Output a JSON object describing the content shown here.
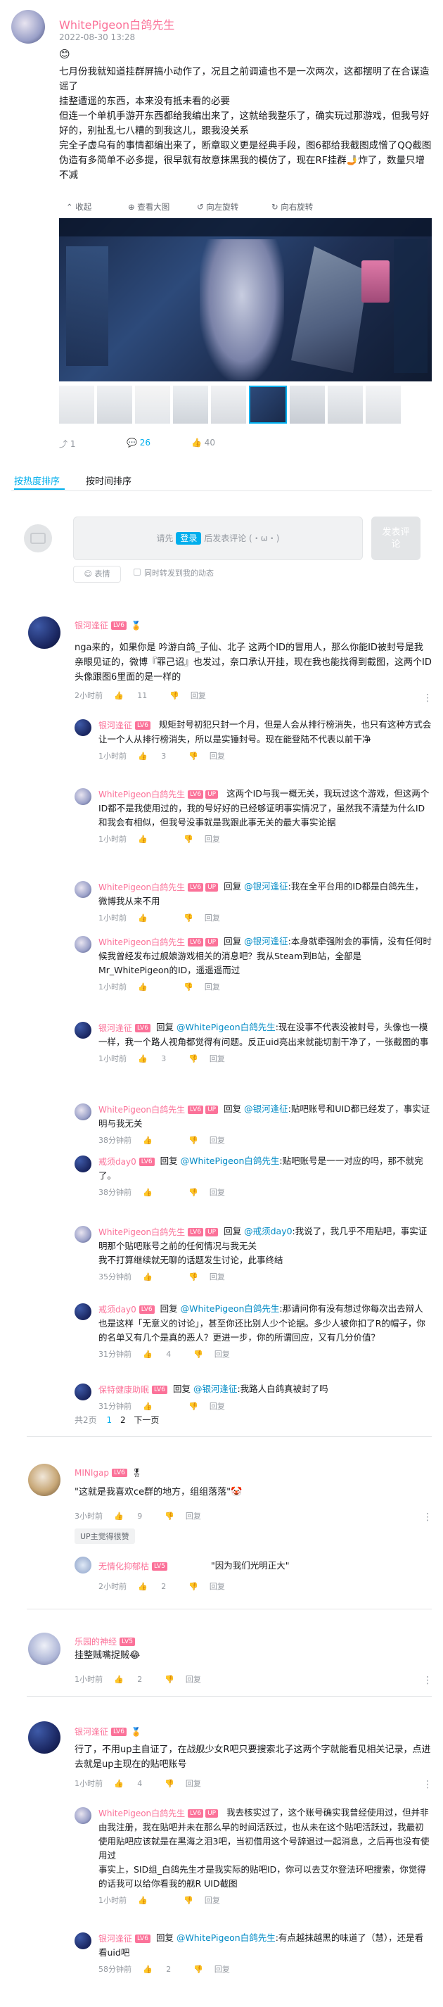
{
  "post": {
    "author": "WhitePigeon白鸽先生",
    "date": "2022-08-30 13:28",
    "emoji": "😊",
    "body": "七月份我就知道挂群屏搞小动作了，况且之前调遣也不是一次两次，这都摆明了在合谋造谣了\n挂整遭遥的东西，本来没有抵未看的必要\n但连一个单机手游开东西都给我编出来了，这就给我整乐了，确实玩过那游戏，但我号好好的，别扯乱七八糟的到我这儿，跟我没关系\n完全子虚乌有的事情都编出来了，断章取义更是经典手段，图6都给我截图成憎了QQ截图伪造有多简单不必多提，很早就有故意抹黑我的模仿了，现在RF挂群🤳炸了，数量只增不减",
    "viewer": {
      "collapse": "收起",
      "view_large": "查看大图",
      "rotate_left": "向左旋转",
      "rotate_right": "向右旋转"
    },
    "stats": {
      "forward": "1",
      "comment": "26",
      "like": "40"
    }
  },
  "sort": {
    "hot": "按热度排序",
    "time": "按时间排序"
  },
  "editor": {
    "prefix": "请先",
    "login": "登录",
    "suffix": "后发表评论 (・ω・)",
    "send": "发表评论",
    "emoji": "表情",
    "checkbox": "同时转发到我的动态"
  },
  "comments": [
    {
      "user": "银河逢征",
      "text": "nga来的，如果你是 吟游白鸽_子仙、北子 这两个ID的冒用人，那么你能ID被封号是我亲眼见证的，微博『罪己诏』也发过，奈口承认开挂，现在我也能找得到截图，这两个ID头像跟图6里面的是一样的",
      "time": "2小时前",
      "likes": "11",
      "reply": "回复"
    },
    {
      "user": "MINIgap",
      "text": "\"这就是我喜欢ce群的地方，组组落落\"🤡",
      "time": "3小时前",
      "likes": "9",
      "reply": "回复",
      "up": "UP主觉得很赞"
    },
    {
      "user": "乐园的神经",
      "text": "挂整贼嘴捉贼😂",
      "time": "1小时前",
      "likes": "2",
      "reply": "回复"
    },
    {
      "user": "银河逢征",
      "text": "行了，不用up主自证了，在战舰少女R吧只要搜索北子这两个字就能看见相关记录，点进去就是up主现在的贴吧账号",
      "time": "1小时前",
      "likes": "4",
      "reply": "回复"
    }
  ],
  "subs1": [
    {
      "user": "银河逢征",
      "text": "规矩封号初犯只封一个月，但是人会从排行榜消失，也只有这种方式会让一个人从排行榜消失，所以是实锤封号。现在能登陆不代表以前干净",
      "time": "1小时前",
      "likes": "3",
      "reply": "回复"
    },
    {
      "user": "WhitePigeon白鸽先生",
      "text": "这两个ID与我一概无关，我玩过这个游戏，但这两个ID都不是我使用过的，我的号好好的已经够证明事实情况了，虽然我不清楚为什么ID和我会有相似，但我号没事就是我跟此事无关的最大事实论据",
      "time": "1小时前",
      "likes": "",
      "reply": "回复"
    },
    {
      "user": "WhitePigeon白鸽先生",
      "pre": "回复",
      "at": "@银河逢征",
      "text": ":我在全平台用的ID都是白鸽先生，微博我从来不用",
      "time": "1小时前",
      "likes": "",
      "reply": "回复"
    },
    {
      "user": "WhitePigeon白鸽先生",
      "pre": "回复",
      "at": "@银河逢征",
      "text": ":本身就牵强附会的事情，没有任何时候我曾经发布过舰娘游戏相关的消息吧？我从Steam到B站，全部是Mr_WhitePigeon的ID，遥遥遥而过",
      "time": "1小时前",
      "likes": "",
      "reply": "回复"
    },
    {
      "user": "银河逢征",
      "pre": "回复",
      "at": "@WhitePigeon白鸽先生",
      "text": ":现在没事不代表没被封号，头像也一模一样，我一个路人视角都觉得有问题。反正uid亮出来就能切割干净了，一张截图的事",
      "time": "1小时前",
      "likes": "3",
      "reply": "回复"
    },
    {
      "user": "WhitePigeon白鸽先生",
      "pre": "回复",
      "at": "@银河逢征",
      "text": ":贴吧账号和UID都已经发了，事实证明与我无关",
      "time": "38分钟前",
      "likes": "",
      "reply": "回复"
    },
    {
      "user": "戒须day0",
      "pre": "回复",
      "at": "@WhitePigeon白鸽先生",
      "text": ":贴吧账号是一一对应的吗，那不就完了。",
      "time": "38分钟前",
      "likes": "",
      "reply": "回复"
    },
    {
      "user": "WhitePigeon白鸽先生",
      "pre": "回复",
      "at": "@戒须day0",
      "text": ":我说了，我几乎不用贴吧，事实证明那个贴吧账号之前的任何情况与我无关\n我不打算继续就无聊的话题发生讨论，此事终结",
      "time": "35分钟前",
      "likes": "",
      "reply": "回复"
    },
    {
      "user": "戒须day0",
      "pre": "回复",
      "at": "@WhitePigeon白鸽先生",
      "text": ":那请问你有没有想过你每次出去辩人也是这样「无意义的讨论」，甚至你还比别人少个论据。多少人被你扣了R的帽子，你的名单又有几个是真的恶人？更进一步，你的所谓回应，又有几分价值？",
      "time": "31分钟前",
      "likes": "4",
      "reply": "回复"
    },
    {
      "user": "保特健康助眠",
      "pre": "回复",
      "at": "@银河逢征",
      "text": ":我路人白鸽真被封了吗",
      "time": "31分钟前",
      "likes": "",
      "reply": "回复"
    }
  ],
  "pager": {
    "total": "共2页",
    "p1": "1",
    "p2": "2",
    "next": "下一页"
  },
  "sub2": {
    "user": "无情化抑郁枯",
    "text": "\"因为我们光明正大\"",
    "time": "2小时前",
    "likes": "2",
    "reply": "回复"
  },
  "subs4": [
    {
      "user": "WhitePigeon白鸽先生",
      "text": "我去核实过了，这个账号确实我曾经使用过，但并非由我注册，我在贴吧并未在那么早的时间活跃过，也从未在这个贴吧活跃过，我最初使用贴吧应该就是在黑海之泪3吧，当初借用这个号辞退过一起消息，之后再也没有使用过\n事实上，SID组_白鸽先生才是我实际的贴吧ID，你可以去艾尔登法环吧搜索，你觉得的话我可以给你看我的舰R UID截图",
      "time": "1小时前",
      "likes": "",
      "reply": "回复"
    },
    {
      "user": "银河逢征",
      "pre": "回复",
      "at": "@WhitePigeon白鸽先生",
      "text": ":有点越抹越黑的味道了（慧），还是看看uid吧",
      "time": "58分钟前",
      "likes": "2",
      "reply": "回复"
    }
  ]
}
